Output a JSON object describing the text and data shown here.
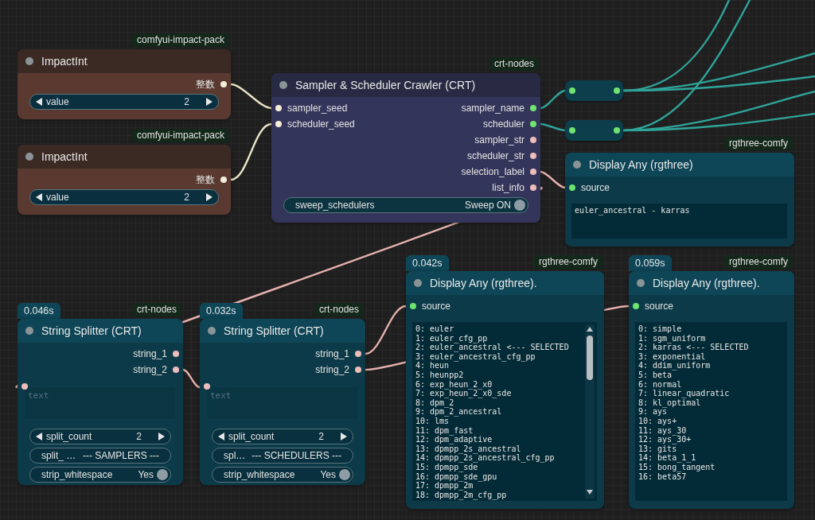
{
  "nodes": [
    {
      "kind": "int",
      "badge": "comfyui-impact-pack",
      "title": "ImpactInt",
      "outputs": [
        {
          "label": "整数",
          "color": "#f3eed8"
        }
      ],
      "widgets": [
        {
          "kind": "number",
          "label": "value",
          "value": "2"
        }
      ]
    },
    {
      "kind": "int",
      "badge": "comfyui-impact-pack",
      "title": "ImpactInt",
      "outputs": [
        {
          "label": "整数",
          "color": "#f3eed8"
        }
      ],
      "widgets": [
        {
          "kind": "number",
          "label": "value",
          "value": "2"
        }
      ]
    },
    {
      "kind": "crawler",
      "badge": "crt-nodes",
      "title": "Sampler & Scheduler Crawler (CRT)",
      "inputs": [
        {
          "label": "sampler_seed",
          "color": "#f3eed8"
        },
        {
          "label": "scheduler_seed",
          "color": "#f3eed8"
        }
      ],
      "outputs": [
        {
          "label": "sampler_name",
          "color": "#6ee46e"
        },
        {
          "label": "scheduler",
          "color": "#6ee46e"
        },
        {
          "label": "sampler_str",
          "color": "#ebbdbb"
        },
        {
          "label": "scheduler_str",
          "color": "#ebbdbb"
        },
        {
          "label": "selection_label",
          "color": "#ebbdbb"
        },
        {
          "label": "list_info",
          "color": "#ebbdbb"
        }
      ],
      "widgets": [
        {
          "kind": "toggle",
          "label": "sweep_schedulers",
          "value": "Sweep ON",
          "on": true
        }
      ]
    },
    {
      "kind": "display",
      "badge": "rgthree-comfy",
      "title": "Display Any (rgthree)",
      "inputs": [
        {
          "label": "source",
          "color": "#6ee46e"
        }
      ],
      "output_lines": [
        "euler_ancestral - karras"
      ]
    },
    {
      "kind": "splitter",
      "time": "0.046s",
      "badge": "crt-nodes",
      "title": "String Splitter (CRT)",
      "outputs": [
        {
          "label": "string_1",
          "color": "#ebbdbb"
        },
        {
          "label": "string_2",
          "color": "#ebbdbb"
        }
      ],
      "widgets": [
        {
          "kind": "textarea",
          "placeholder": "text",
          "color": "#ebbdbb"
        },
        {
          "kind": "number",
          "label": "split_count",
          "value": "2"
        },
        {
          "kind": "text",
          "label": "split_ …",
          "value": "--- SAMPLERS ---"
        },
        {
          "kind": "toggle",
          "label": "strip_whitespace",
          "value": "Yes",
          "on": true
        }
      ]
    },
    {
      "kind": "splitter",
      "time": "0.032s",
      "badge": "crt-nodes",
      "title": "String Splitter (CRT)",
      "outputs": [
        {
          "label": "string_1",
          "color": "#ebbdbb"
        },
        {
          "label": "string_2",
          "color": "#ebbdbb"
        }
      ],
      "widgets": [
        {
          "kind": "textarea",
          "placeholder": "text",
          "color": "#ebbdbb"
        },
        {
          "kind": "number",
          "label": "split_count",
          "value": "2"
        },
        {
          "kind": "text",
          "label": "spl…",
          "value": "--- SCHEDULERS ---"
        },
        {
          "kind": "toggle",
          "label": "strip_whitespace",
          "value": "Yes",
          "on": true
        }
      ]
    },
    {
      "kind": "display",
      "time": "0.042s",
      "badge": "rgthree-comfy",
      "title": "Display Any (rgthree).",
      "inputs": [
        {
          "label": "source",
          "color": "#6ee46e"
        }
      ],
      "output_lines": [
        "0: euler",
        "1: euler_cfg_pp",
        "2: euler_ancestral <--- SELECTED",
        "3: euler_ancestral_cfg_pp",
        "4: heun",
        "5: heunpp2",
        "6: exp_heun_2_x0",
        "7: exp_heun_2_x0_sde",
        "8: dpm_2",
        "9: dpm_2_ancestral",
        "10: lms",
        "11: dpm_fast",
        "12: dpm_adaptive",
        "13: dpmpp_2s_ancestral",
        "14: dpmpp_2s_ancestral_cfg_pp",
        "15: dpmpp_sde",
        "16: dpmpp_sde_gpu",
        "17: dpmpp_2m",
        "18: dpmpp_2m_cfg_pp"
      ]
    },
    {
      "kind": "display",
      "time": "0.059s",
      "badge": "rgthree-comfy",
      "title": "Display Any (rgthree).",
      "inputs": [
        {
          "label": "source",
          "color": "#6ee46e"
        }
      ],
      "output_lines": [
        "0: simple",
        "1: sgm_uniform",
        "2: karras <--- SELECTED",
        "3: exponential",
        "4: ddim_uniform",
        "5: beta",
        "6: normal",
        "7: linear_quadratic",
        "8: kl_optimal",
        "9: ays",
        "10: ays+",
        "11: ays_30",
        "12: ays_30+",
        "13: gits",
        "14: beta_1_1",
        "15: bong_tangent",
        "16: beta57"
      ]
    }
  ]
}
